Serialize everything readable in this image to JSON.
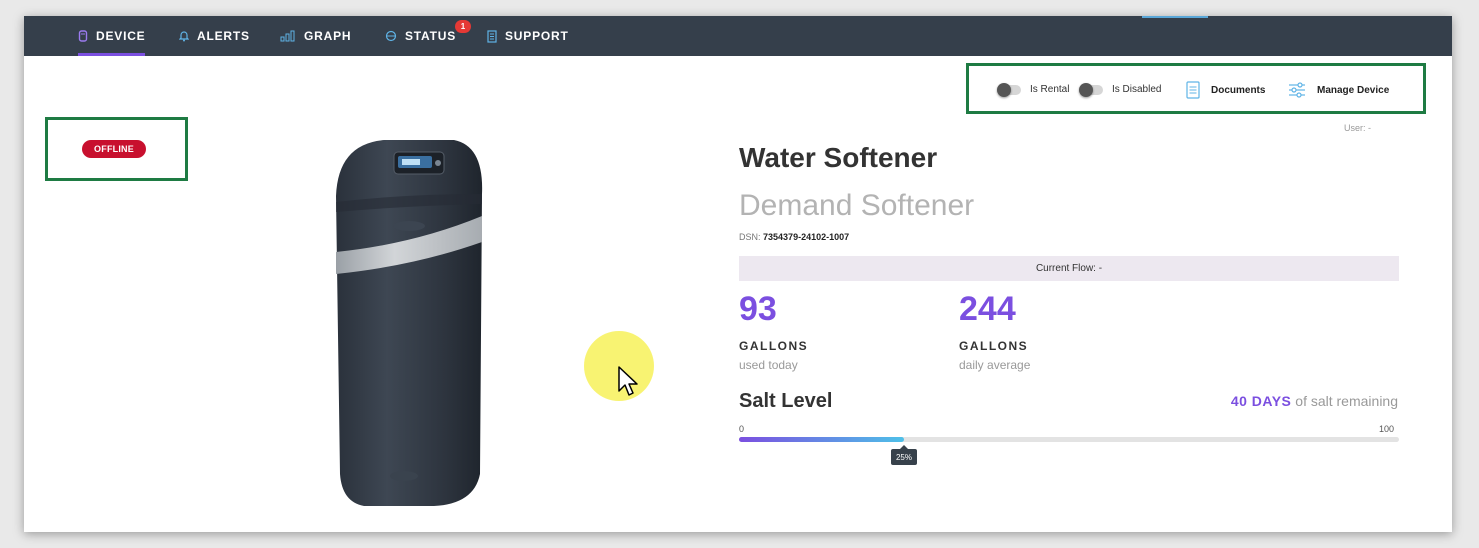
{
  "nav": {
    "tabs": [
      {
        "label": "DEVICE",
        "icon": "device-icon",
        "active": true
      },
      {
        "label": "ALERTS",
        "icon": "bell-icon"
      },
      {
        "label": "GRAPH",
        "icon": "bar-graph-icon"
      },
      {
        "label": "STATUS",
        "icon": "status-icon",
        "badge": "1"
      },
      {
        "label": "SUPPORT",
        "icon": "document-icon"
      }
    ]
  },
  "toolbar": {
    "is_rental_label": "Is Rental",
    "is_disabled_label": "Is Disabled",
    "documents_label": "Documents",
    "manage_device_label": "Manage Device"
  },
  "user_label": "User: -",
  "device": {
    "status": "OFFLINE",
    "title": "Water Softener",
    "subtitle": "Demand Softener",
    "dsn_label": "DSN:",
    "dsn_value": "7354379-24102-1007",
    "current_flow": "Current Flow: -"
  },
  "stats": [
    {
      "value": "93",
      "unit": "GALLONS",
      "caption": "used today"
    },
    {
      "value": "244",
      "unit": "GALLONS",
      "caption": "daily average"
    }
  ],
  "salt": {
    "label": "Salt Level",
    "days": "40 DAYS",
    "remaining_text": "of salt remaining",
    "min": "0",
    "max": "100",
    "level_text": "25%",
    "level_fraction": 0.25
  },
  "colors": {
    "nav_bg": "#353f4b",
    "accent": "#7b4fe0",
    "offline": "#c8102e",
    "highlight_border": "#1e7b43"
  }
}
